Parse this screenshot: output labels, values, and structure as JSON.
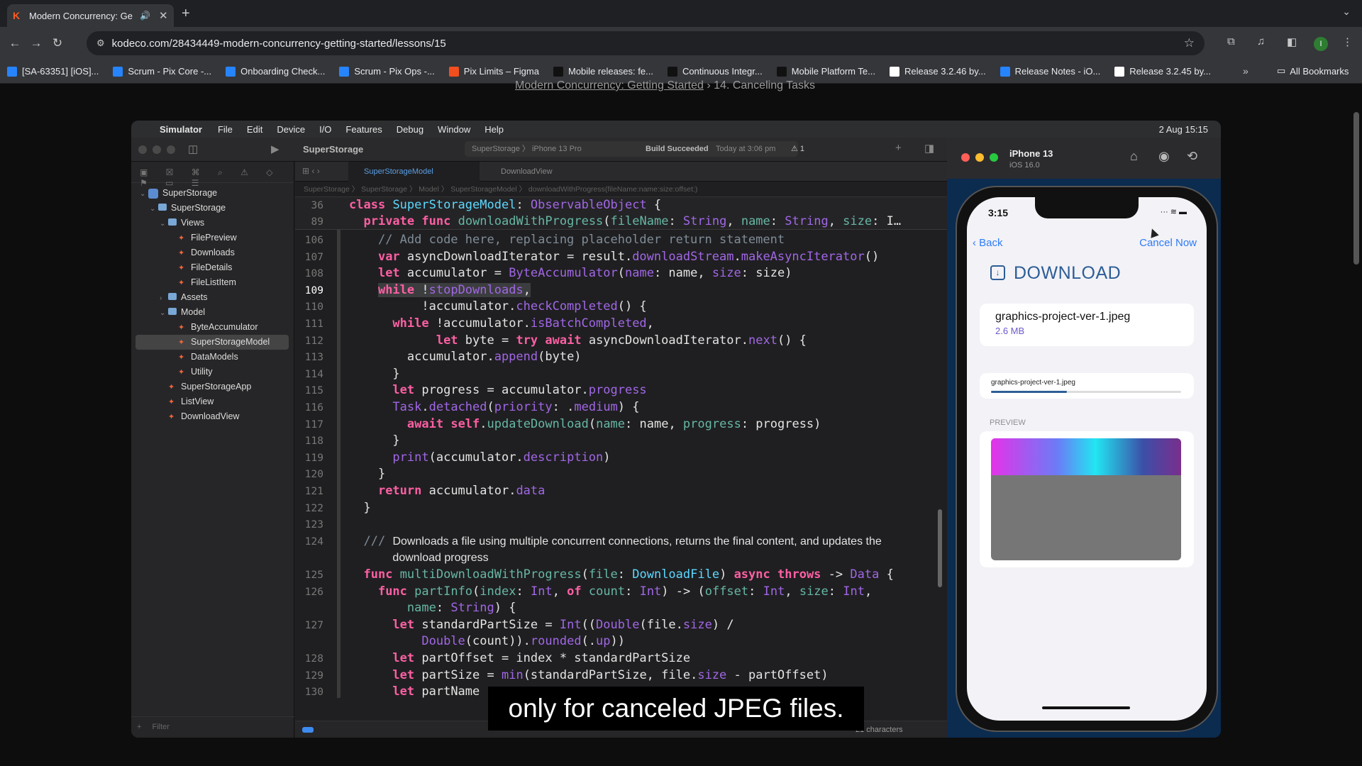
{
  "browser": {
    "tab_title": "Modern Concurrency: Ge",
    "url": "kodeco.com/28434449-modern-concurrency-getting-started/lessons/15",
    "bookmarks": [
      {
        "label": "[SA-63351] [iOS]...",
        "color": "#2684ff"
      },
      {
        "label": "Scrum - Pix Core -...",
        "color": "#2684ff"
      },
      {
        "label": "Onboarding Check...",
        "color": "#2684ff"
      },
      {
        "label": "Scrum - Pix Ops -...",
        "color": "#2684ff"
      },
      {
        "label": "Pix Limits – Figma",
        "color": "#f24e1e"
      },
      {
        "label": "Mobile releases: fe...",
        "color": "#111111"
      },
      {
        "label": "Continuous Integr...",
        "color": "#111111"
      },
      {
        "label": "Mobile Platform Te...",
        "color": "#111111"
      },
      {
        "label": "Release 3.2.46 by...",
        "color": "#ffffff"
      },
      {
        "label": "Release Notes - iO...",
        "color": "#2684ff"
      },
      {
        "label": "Release 3.2.45 by...",
        "color": "#ffffff"
      }
    ],
    "all_bookmarks": "All Bookmarks",
    "avatar_letter": "I"
  },
  "page": {
    "breadcrumb_link": "Modern Concurrency: Getting Started",
    "breadcrumb_current": "14. Canceling Tasks"
  },
  "mac": {
    "menu": [
      "Simulator",
      "File",
      "Edit",
      "Device",
      "I/O",
      "Features",
      "Debug",
      "Window",
      "Help"
    ],
    "date_time": "2 Aug  15:15"
  },
  "xcode": {
    "project": "SuperStorage",
    "scheme": "SuperStorage  〉 iPhone 13 Pro",
    "build_status": "Build Succeeded",
    "build_time": "Today at 3:06 pm",
    "warnings": "⚠ 1",
    "tab_active": "SuperStorageModel",
    "tab_other": "DownloadView",
    "jumpbar": "SuperStorage 〉 SuperStorage 〉 Model 〉 SuperStorageModel 〉 downloadWithProgress(fileName:name:size:offset:)",
    "navigator": [
      {
        "label": "SuperStorage",
        "indent": 0,
        "chev": "⌄",
        "kind": "proj"
      },
      {
        "label": "SuperStorage",
        "indent": 1,
        "chev": "⌄",
        "kind": "folder"
      },
      {
        "label": "Views",
        "indent": 2,
        "chev": "⌄",
        "kind": "folder"
      },
      {
        "label": "FilePreview",
        "indent": 3,
        "chev": "",
        "kind": "swift"
      },
      {
        "label": "Downloads",
        "indent": 3,
        "chev": "",
        "kind": "swift"
      },
      {
        "label": "FileDetails",
        "indent": 3,
        "chev": "",
        "kind": "swift"
      },
      {
        "label": "FileListItem",
        "indent": 3,
        "chev": "",
        "kind": "swift"
      },
      {
        "label": "Assets",
        "indent": 2,
        "chev": "›",
        "kind": "folder"
      },
      {
        "label": "Model",
        "indent": 2,
        "chev": "⌄",
        "kind": "folder"
      },
      {
        "label": "ByteAccumulator",
        "indent": 3,
        "chev": "",
        "kind": "swift"
      },
      {
        "label": "SuperStorageModel",
        "indent": 3,
        "chev": "",
        "kind": "swift",
        "selected": true
      },
      {
        "label": "DataModels",
        "indent": 3,
        "chev": "",
        "kind": "swift"
      },
      {
        "label": "Utility",
        "indent": 3,
        "chev": "",
        "kind": "swift"
      },
      {
        "label": "SuperStorageApp",
        "indent": 2,
        "chev": "",
        "kind": "swift"
      },
      {
        "label": "ListView",
        "indent": 2,
        "chev": "",
        "kind": "swift"
      },
      {
        "label": "DownloadView",
        "indent": 2,
        "chev": "",
        "kind": "swift"
      }
    ],
    "filter_placeholder": "Filter",
    "sticky": [
      {
        "n": "36",
        "html": "<span class=\"kw\">class</span> <span class=\"ty\">SuperStorageModel</span>: <span class=\"mp\">ObservableObject</span> {"
      },
      {
        "n": "89",
        "html": "  <span class=\"kw\">private</span> <span class=\"kw\">func</span> <span class=\"fn\">downloadWithProgress</span>(<span class=\"fn\">fileName</span>: <span class=\"mp\">String</span>, <span class=\"fn\">name</span>: <span class=\"mp\">String</span>, <span class=\"fn\">size</span>: I…"
      }
    ],
    "lines": [
      {
        "n": "106",
        "html": "    <span class=\"cm\">// Add code here, replacing placeholder return statement</span>"
      },
      {
        "n": "107",
        "html": "    <span class=\"kw\">var</span> asyncDownloadIterator = result.<span class=\"mp\">downloadStream</span>.<span class=\"mp\">makeAsyncIterator</span>()"
      },
      {
        "n": "108",
        "html": "    <span class=\"kw\">let</span> accumulator = <span class=\"mp\">ByteAccumulator</span>(<span class=\"mp\">name</span>: name, <span class=\"mp\">size</span>: size)"
      },
      {
        "n": "109",
        "cur": true,
        "html": "    <span class=\"hl\"><span class=\"kw\">while</span> !<span class=\"mp\">stopDownloads</span>,</span>"
      },
      {
        "n": "110",
        "html": "          !accumulator.<span class=\"mp\">checkCompleted</span>() {"
      },
      {
        "n": "111",
        "html": "      <span class=\"kw\">while</span> !accumulator.<span class=\"mp\">isBatchCompleted</span>,"
      },
      {
        "n": "112",
        "html": "            <span class=\"kw\">let</span> byte = <span class=\"kw\">try</span> <span class=\"kw\">await</span> asyncDownloadIterator.<span class=\"mp\">next</span>() {"
      },
      {
        "n": "113",
        "html": "        accumulator.<span class=\"mp\">append</span>(byte)"
      },
      {
        "n": "114",
        "html": "      }"
      },
      {
        "n": "115",
        "html": "      <span class=\"kw\">let</span> progress = accumulator.<span class=\"mp\">progress</span>"
      },
      {
        "n": "116",
        "html": "      <span class=\"mp\">Task</span>.<span class=\"mp\">detached</span>(<span class=\"mp\">priority</span>: .<span class=\"mp\">medium</span>) {"
      },
      {
        "n": "117",
        "html": "        <span class=\"kw\">await</span> <span class=\"kw\">self</span>.<span class=\"fn\">updateDownload</span>(<span class=\"fn\">name</span>: name, <span class=\"fn\">progress</span>: progress)"
      },
      {
        "n": "118",
        "html": "      }"
      },
      {
        "n": "119",
        "html": "      <span class=\"mp\">print</span>(accumulator.<span class=\"mp\">description</span>)"
      },
      {
        "n": "120",
        "html": "    }"
      },
      {
        "n": "121",
        "html": "    <span class=\"kw\">return</span> accumulator.<span class=\"mp\">data</span>"
      },
      {
        "n": "122",
        "html": "  }"
      },
      {
        "n": "123",
        "html": ""
      },
      {
        "n": "124",
        "html": "  <span class=\"cm\">///</span> <span class=\"cmt\">Downloads a file using multiple concurrent connections, returns the final content, and updates the</span>"
      },
      {
        "n": "",
        "html": "      <span class=\"cmt\">download progress</span>"
      },
      {
        "n": "125",
        "html": "  <span class=\"kw\">func</span> <span class=\"fn\">multiDownloadWithProgress</span>(<span class=\"fn\">file</span>: <span class=\"ty\">DownloadFile</span>) <span class=\"kw\">async</span> <span class=\"kw\">throws</span> -&gt; <span class=\"mp\">Data</span> {"
      },
      {
        "n": "126",
        "html": "    <span class=\"kw\">func</span> <span class=\"fn\">partInfo</span>(<span class=\"fn\">index</span>: <span class=\"mp\">Int</span>, <span class=\"kw\">of</span> <span class=\"fn\">count</span>: <span class=\"mp\">Int</span>) -&gt; (<span class=\"fn\">offset</span>: <span class=\"mp\">Int</span>, <span class=\"fn\">size</span>: <span class=\"mp\">Int</span>,"
      },
      {
        "n": "",
        "html": "        <span class=\"fn\">name</span>: <span class=\"mp\">String</span>) {"
      },
      {
        "n": "127",
        "html": "      <span class=\"kw\">let</span> standardPartSize = <span class=\"mp\">Int</span>((<span class=\"mp\">Double</span>(file.<span class=\"mp\">size</span>) /"
      },
      {
        "n": "",
        "html": "          <span class=\"mp\">Double</span>(count)).<span class=\"mp\">rounded</span>(.<span class=\"mp\">up</span>))"
      },
      {
        "n": "128",
        "html": "      <span class=\"kw\">let</span> partOffset = index * standardPartSize"
      },
      {
        "n": "129",
        "html": "      <span class=\"kw\">let</span> partSize = <span class=\"mp\">min</span>(standardPartSize, file.<span class=\"mp\">size</span> - partOffset)"
      },
      {
        "n": "130",
        "html": "      <span class=\"kw\">let</span> partName"
      }
    ],
    "char_count": "21 characters"
  },
  "simulator": {
    "device": "iPhone 13",
    "os": "iOS 16.0",
    "time": "3:15",
    "back": "Back",
    "cancel": "Cancel Now",
    "title": "DOWNLOAD",
    "file_name": "graphics-project-ver-1.jpeg",
    "file_size": "2.6 MB",
    "progress_name": "graphics-project-ver-1.jpeg",
    "progress": 0.4,
    "preview_label": "PREVIEW"
  },
  "caption": "only for canceled JPEG files."
}
